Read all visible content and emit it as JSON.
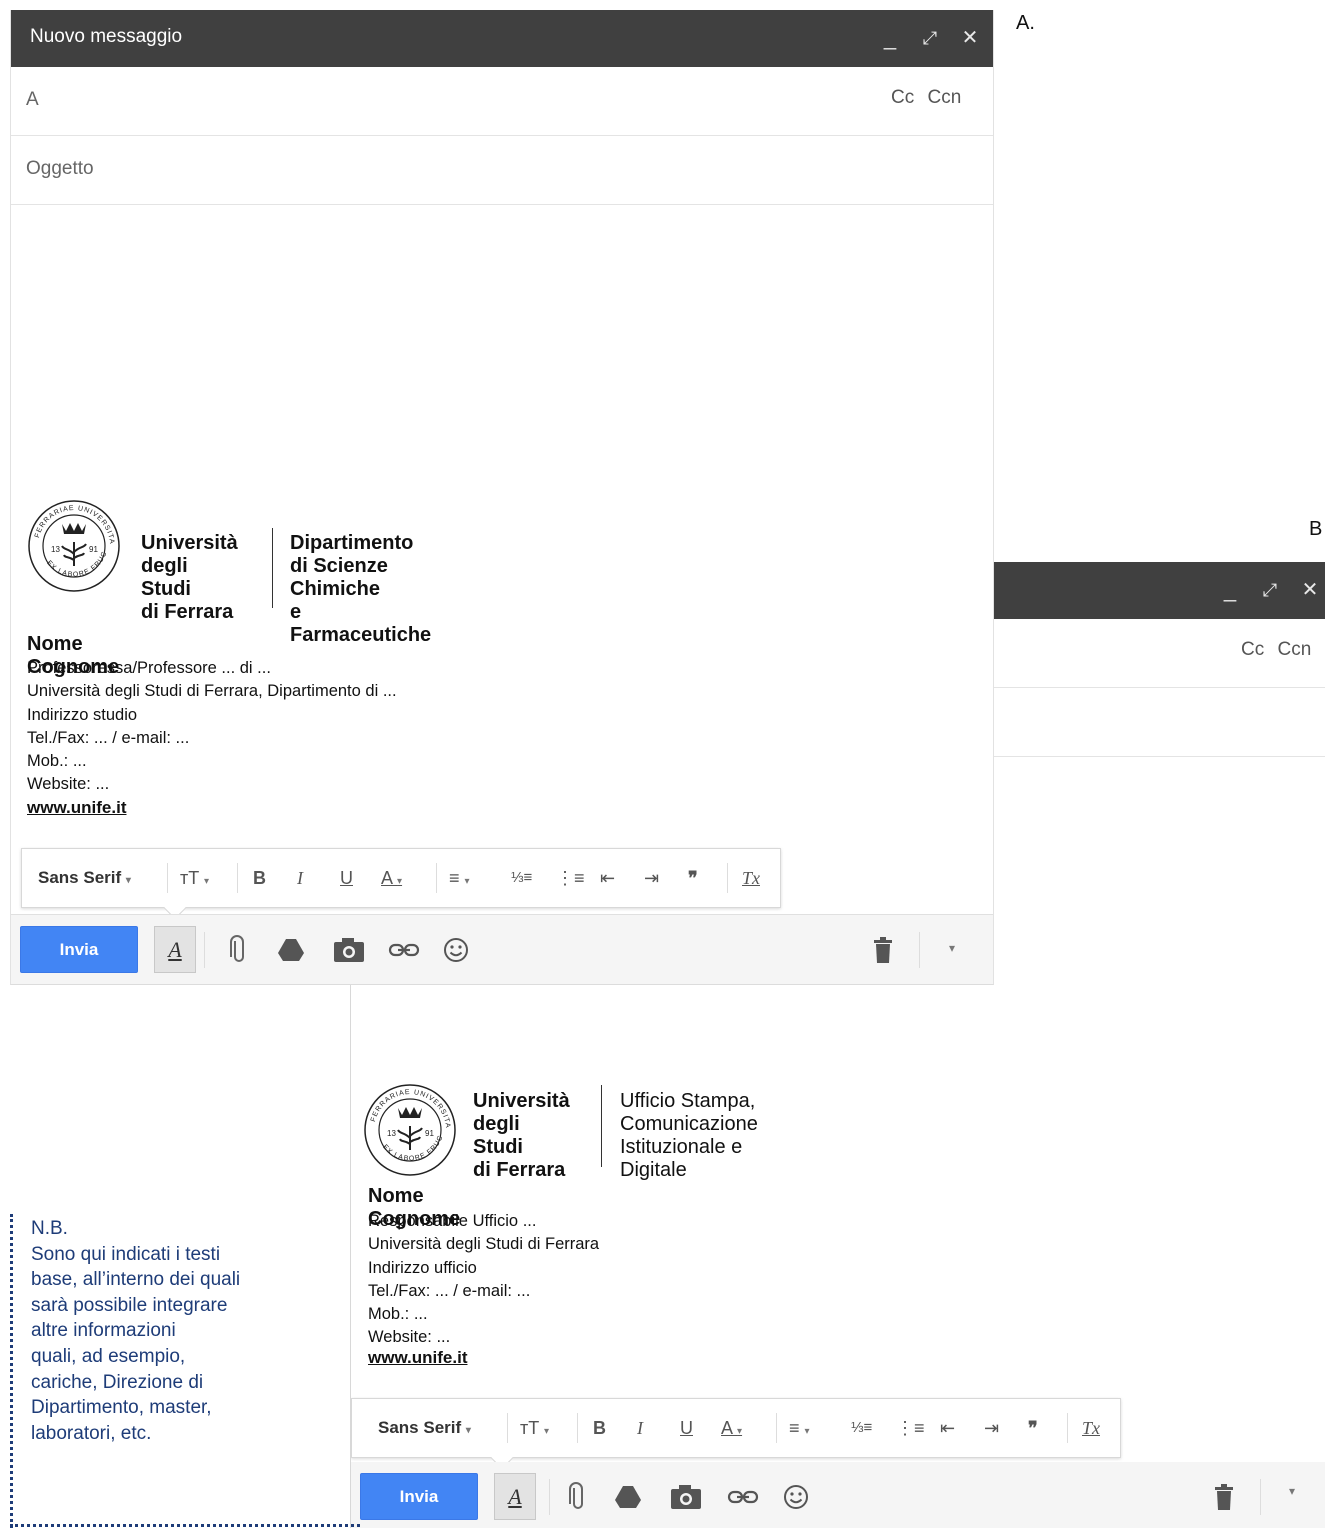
{
  "labels": {
    "a": "A.",
    "b": "B"
  },
  "compose": {
    "title": "Nuovo messaggio",
    "to_label": "A",
    "cc": "Cc",
    "bcc": "Ccn",
    "subject_placeholder": "Oggetto",
    "controls": {
      "minimize": "_",
      "expand": "⤢",
      "close": "✕"
    }
  },
  "signature_a": {
    "university": [
      "Università",
      "degli Studi",
      "di Ferrara"
    ],
    "department": [
      "Dipartimento",
      "di Scienze Chimiche",
      "e Farmaceutiche"
    ],
    "name": "Nome Cognome",
    "lines": [
      "Professoressa/Professore ... di ...",
      "Università degli Studi di Ferrara, Dipartimento di ...",
      "Indirizzo studio",
      "Tel./Fax: ... / e-mail: ...",
      "Mob.: ...",
      "Website: ..."
    ],
    "website": "www.unife.it"
  },
  "signature_b": {
    "university": [
      "Università",
      "degli Studi",
      "di Ferrara"
    ],
    "department": [
      "Ufficio Stampa,",
      "Comunicazione",
      "Istituzionale e Digitale"
    ],
    "name": "Nome Cognome",
    "lines": [
      "Responsabile Ufficio ...",
      "Università degli Studi di Ferrara",
      "Indirizzo ufficio",
      "Tel./Fax: ... / e-mail: ...",
      "Mob.: ...",
      "Website: ..."
    ],
    "website": "www.unife.it"
  },
  "seal": {
    "top_text": "FERRARIAE UNIVERSITAS",
    "bottom_text": "EX LABORE FRUCTUS",
    "left": "13",
    "right": "91"
  },
  "toolbar": {
    "font": "Sans Serif",
    "size_icon": "ᴛT",
    "bold": "B",
    "italic": "I",
    "underline": "U",
    "text_color": "A",
    "align": "≡",
    "numbered": "⅓≡",
    "bulleted": "⋮≡",
    "indent_less": "⇤",
    "indent_more": "⇥",
    "quote": "❞",
    "clear": "Tx",
    "caret": "▾"
  },
  "actions": {
    "send": "Invia",
    "format": "A",
    "more": "▾"
  },
  "note": {
    "lines": [
      "N.B.",
      "Sono qui indicati i testi",
      "base, all’interno dei quali",
      "sarà possibile integrare",
      "altre informazioni",
      "quali, ad esempio,",
      "cariche, Direzione di",
      "Dipartimento, master,",
      "laboratori, etc."
    ]
  },
  "colors": {
    "titlebar": "#404040",
    "send": "#4285f4",
    "note": "#1e3c78"
  }
}
